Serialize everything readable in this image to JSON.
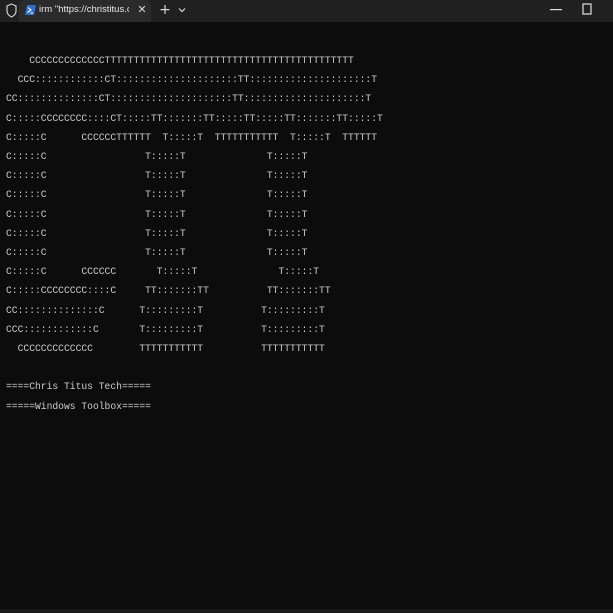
{
  "tab": {
    "title": "irm \"https://christitus.com/win\" | iex",
    "close_glyph": "✕"
  },
  "tabbar": {
    "new_tab_glyph": "+"
  },
  "icons": {
    "shield": "shield-icon",
    "powershell": "powershell-icon",
    "dropdown": "chevron-down-icon",
    "minimize": "minimize-icon",
    "maximize": "maximize-icon"
  },
  "colors": {
    "terminal_bg": "#0c0c0c",
    "terminal_text": "#cccccc",
    "tabbar_bg": "#202020",
    "tab_bg": "#2b2b2b",
    "powershell_blue": "#2a6fd1"
  },
  "console": {
    "lines": [
      "    CCCCCCCCCCCCCTTTTTTTTTTTTTTTTTTTTTTTTTTTTTTTTTTTTTTTTTTT",
      "  CCC::::::::::::CT:::::::::::::::::::::TT:::::::::::::::::::::T",
      "CC::::::::::::::CT:::::::::::::::::::::TT:::::::::::::::::::::T",
      "C:::::CCCCCCCC::::CT:::::TT:::::::TT:::::TT:::::TT:::::::TT:::::T",
      "C:::::C      CCCCCCTTTTTT  T:::::T  TTTTTTTTTTT  T:::::T  TTTTTT",
      "C:::::C                 T:::::T              T:::::T",
      "C:::::C                 T:::::T              T:::::T",
      "C:::::C                 T:::::T              T:::::T",
      "C:::::C                 T:::::T              T:::::T",
      "C:::::C                 T:::::T              T:::::T",
      "C:::::C                 T:::::T              T:::::T",
      "C:::::C      CCCCCC       T:::::T              T:::::T",
      "C:::::CCCCCCCC::::C     TT:::::::TT          TT:::::::TT",
      "CC::::::::::::::C      T:::::::::T          T:::::::::T",
      "CCC::::::::::::C       T:::::::::T          T:::::::::T",
      "  CCCCCCCCCCCCC        TTTTTTTTTTT          TTTTTTTTTTT",
      "",
      "====Chris Titus Tech=====",
      "=====Windows Toolbox====="
    ]
  }
}
